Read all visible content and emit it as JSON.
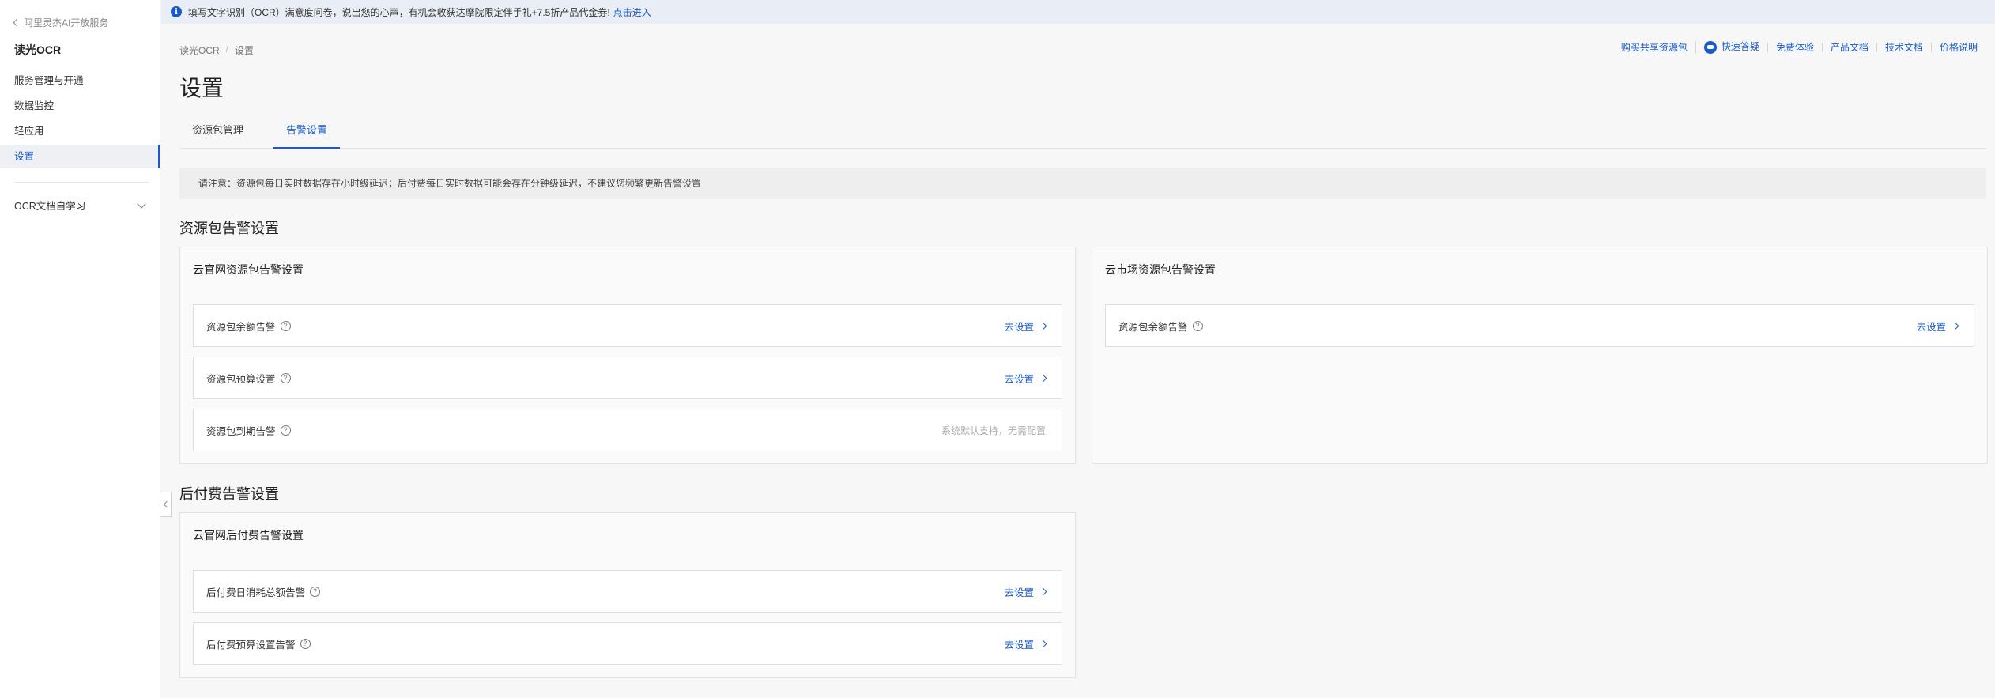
{
  "sidebar": {
    "back_label": "阿里灵杰AI开放服务",
    "product_title": "读光OCR",
    "items": [
      {
        "label": "服务管理与开通"
      },
      {
        "label": "数据监控"
      },
      {
        "label": "轻应用"
      },
      {
        "label": "设置"
      }
    ],
    "group_label": "OCR文档自学习"
  },
  "banner": {
    "text": "填写文字识别（OCR）满意度问卷，说出您的心声，有机会收获达摩院限定伴手礼+7.5折产品代金券!",
    "link_label": "点击进入"
  },
  "breadcrumb": {
    "root": "读光OCR",
    "separator": "/",
    "current": "设置"
  },
  "top_links": {
    "buy": "购买共享资源包",
    "quick_answer": "快速答疑",
    "free_trial": "免费体验",
    "product_docs": "产品文档",
    "tech_docs": "技术文档",
    "pricing": "价格说明"
  },
  "page_title": "设置",
  "tabs": [
    {
      "label": "资源包管理"
    },
    {
      "label": "告警设置"
    }
  ],
  "notice": "请注意：资源包每日实时数据存在小时级延迟；后付费每日实时数据可能会存在分钟级延迟，不建议您频繁更新告警设置",
  "resource_section": {
    "title": "资源包告警设置",
    "aliyun_card": {
      "title": "云官网资源包告警设置",
      "rows": [
        {
          "label": "资源包余额告警",
          "action": "去设置"
        },
        {
          "label": "资源包预算设置",
          "action": "去设置"
        },
        {
          "label": "资源包到期告警",
          "status": "系统默认支持，无需配置"
        }
      ]
    },
    "market_card": {
      "title": "云市场资源包告警设置",
      "rows": [
        {
          "label": "资源包余额告警",
          "action": "去设置"
        }
      ]
    }
  },
  "postpaid_section": {
    "title": "后付费告警设置",
    "aliyun_card": {
      "title": "云官网后付费告警设置",
      "rows": [
        {
          "label": "后付费日消耗总额告警",
          "action": "去设置"
        },
        {
          "label": "后付费预算设置告警",
          "action": "去设置"
        }
      ]
    }
  },
  "colors": {
    "accent": "#1a5bc9",
    "banner_bg": "#e8edf6",
    "page_bg": "#f7f7f7"
  }
}
